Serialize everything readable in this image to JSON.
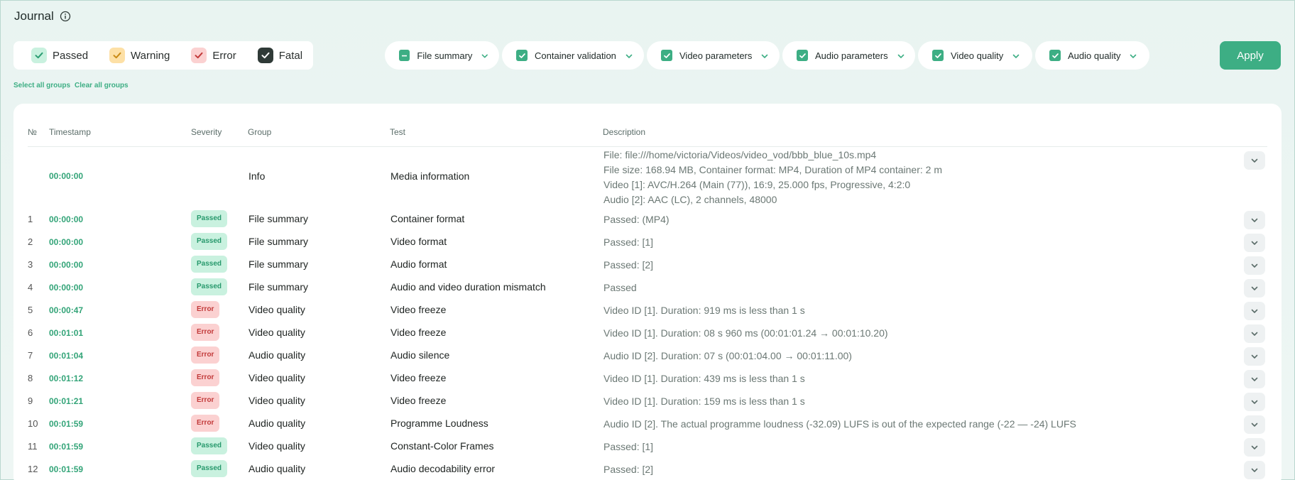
{
  "page": {
    "title": "Journal"
  },
  "severities": [
    {
      "label": "Passed",
      "box": "#c9f1df",
      "check": "#2a9d72"
    },
    {
      "label": "Warning",
      "box": "#fde0a6",
      "check": "#c98a15"
    },
    {
      "label": "Error",
      "box": "#fbd1d1",
      "check": "#c23a3a"
    },
    {
      "label": "Fatal",
      "box": "#2f3a37",
      "check": "#ffffff"
    }
  ],
  "groups": [
    {
      "label": "File summary",
      "state": "partial"
    },
    {
      "label": "Container validation",
      "state": "checked"
    },
    {
      "label": "Video parameters",
      "state": "checked"
    },
    {
      "label": "Audio parameters",
      "state": "checked"
    },
    {
      "label": "Video quality",
      "state": "checked"
    },
    {
      "label": "Audio quality",
      "state": "checked"
    }
  ],
  "apply_label": "Apply",
  "links": {
    "select_all": "Select all groups",
    "clear_all": "Clear all groups"
  },
  "columns": {
    "no": "№",
    "timestamp": "Timestamp",
    "severity": "Severity",
    "group": "Group",
    "test": "Test",
    "description": "Description"
  },
  "info_row": {
    "timestamp": "00:00:00",
    "group": "Info",
    "test": "Media information",
    "description": [
      "File: file:///home/victoria/Videos/video_vod/bbb_blue_10s.mp4",
      "File size: 168.94 MB, Container format: MP4, Duration of MP4 container: 2 m",
      "Video [1]: AVC/H.264 (Main (77)), 16:9, 25.000 fps, Progressive, 4:2:0",
      "Audio [2]: AAC (LC), 2 channels, 48000"
    ]
  },
  "rows": [
    {
      "no": "1",
      "timestamp": "00:00:00",
      "severity": "Passed",
      "group": "File summary",
      "test": "Container format",
      "description": "Passed: (MP4)"
    },
    {
      "no": "2",
      "timestamp": "00:00:00",
      "severity": "Passed",
      "group": "File summary",
      "test": "Video format",
      "description": "Passed: [1]"
    },
    {
      "no": "3",
      "timestamp": "00:00:00",
      "severity": "Passed",
      "group": "File summary",
      "test": "Audio format",
      "description": "Passed: [2]"
    },
    {
      "no": "4",
      "timestamp": "00:00:00",
      "severity": "Passed",
      "group": "File summary",
      "test": "Audio and video duration mismatch",
      "description": "Passed"
    },
    {
      "no": "5",
      "timestamp": "00:00:47",
      "severity": "Error",
      "group": "Video quality",
      "test": "Video freeze",
      "description": "Video ID [1]. Duration: 919 ms is less than 1 s"
    },
    {
      "no": "6",
      "timestamp": "00:01:01",
      "severity": "Error",
      "group": "Video quality",
      "test": "Video freeze",
      "description": "Video ID [1]. Duration: 08 s 960 ms (00:01:01.24 → 00:01:10.20)"
    },
    {
      "no": "7",
      "timestamp": "00:01:04",
      "severity": "Error",
      "group": "Audio quality",
      "test": "Audio silence",
      "description": "Audio ID [2]. Duration: 07 s (00:01:04.00 → 00:01:11.00)"
    },
    {
      "no": "8",
      "timestamp": "00:01:12",
      "severity": "Error",
      "group": "Video quality",
      "test": "Video freeze",
      "description": "Video ID [1]. Duration: 439 ms is less than 1 s"
    },
    {
      "no": "9",
      "timestamp": "00:01:21",
      "severity": "Error",
      "group": "Video quality",
      "test": "Video freeze",
      "description": "Video ID [1]. Duration: 159 ms is less than 1 s"
    },
    {
      "no": "10",
      "timestamp": "00:01:59",
      "severity": "Error",
      "group": "Audio quality",
      "test": "Programme Loudness",
      "description": "Audio ID [2]. The actual programme loudness (-32.09) LUFS is out of the expected range (-22  —  -24) LUFS"
    },
    {
      "no": "11",
      "timestamp": "00:01:59",
      "severity": "Passed",
      "group": "Video quality",
      "test": "Constant-Color Frames",
      "description": "Passed: [1]"
    },
    {
      "no": "12",
      "timestamp": "00:01:59",
      "severity": "Passed",
      "group": "Audio quality",
      "test": "Audio decodability error",
      "description": "Passed: [2]"
    }
  ]
}
